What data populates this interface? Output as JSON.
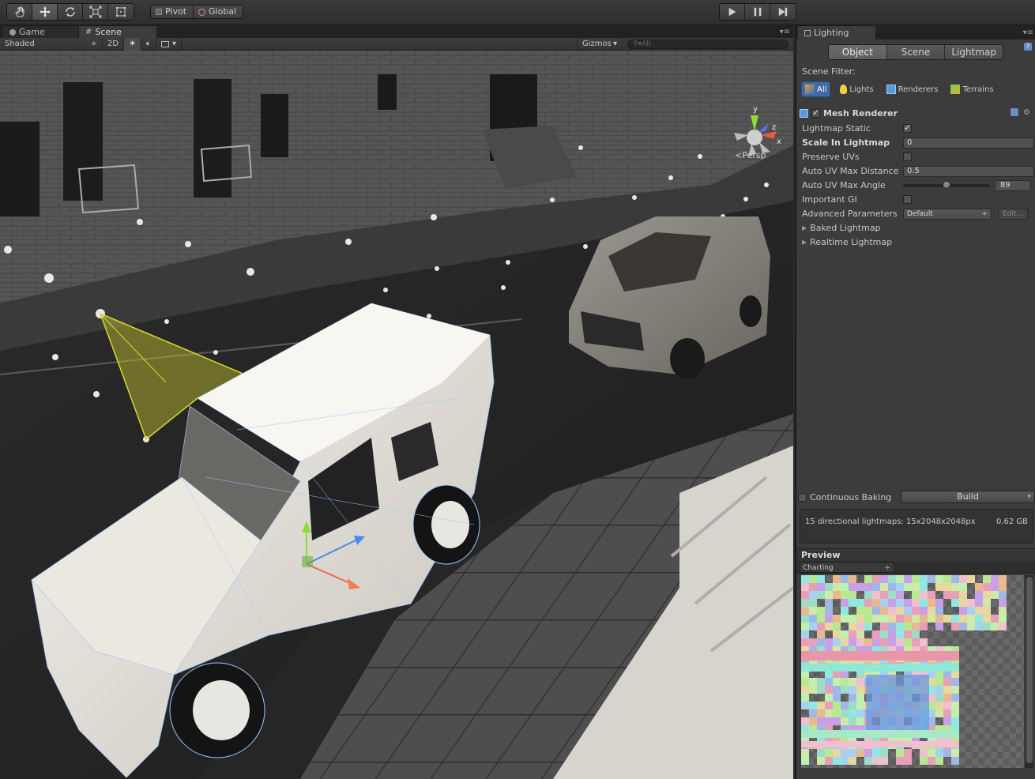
{
  "toolbar": {
    "pivot_label": "Pivot",
    "global_label": "Global"
  },
  "scene_panel": {
    "tabs": {
      "game": "Game",
      "scene": "Scene"
    },
    "shading_mode": "Shaded",
    "mode_2d": "2D",
    "gizmos_label": "Gizmos",
    "search_placeholder": "All",
    "projection_label": "Persp",
    "gizmo_axes": {
      "x": "x",
      "y": "y",
      "z": "z"
    }
  },
  "lighting": {
    "tab_title": "Lighting",
    "mode_tabs": [
      "Object",
      "Scene",
      "Lightmap"
    ],
    "scene_filter_label": "Scene Filter:",
    "filters": [
      "All",
      "Lights",
      "Renderers",
      "Terrains"
    ],
    "component_title": "Mesh Renderer",
    "properties": {
      "lightmap_static_label": "Lightmap Static",
      "scale_in_lightmap_label": "Scale In Lightmap",
      "scale_in_lightmap_value": "0",
      "preserve_uvs_label": "Preserve UVs",
      "auto_uv_max_distance_label": "Auto UV Max Distance",
      "auto_uv_max_distance_value": "0.5",
      "auto_uv_max_angle_label": "Auto UV Max Angle",
      "auto_uv_max_angle_value": "89",
      "auto_uv_max_angle_fraction": 0.5,
      "important_gi_label": "Important GI",
      "advanced_parameters_label": "Advanced Parameters",
      "advanced_parameters_value": "Default",
      "edit_label": "Edit..."
    },
    "foldouts": [
      "Baked Lightmap",
      "Realtime Lightmap"
    ],
    "continuous_baking_label": "Continuous Baking",
    "build_label": "Build",
    "lightmap_info": "15 directional lightmaps: 15x2048x2048px",
    "lightmap_size": "0.62 GB",
    "preview_title": "Preview",
    "preview_mode": "Charting"
  },
  "colors": {
    "accent_blue": "#3f6aa6",
    "cone_yellow": "#c8c830"
  }
}
